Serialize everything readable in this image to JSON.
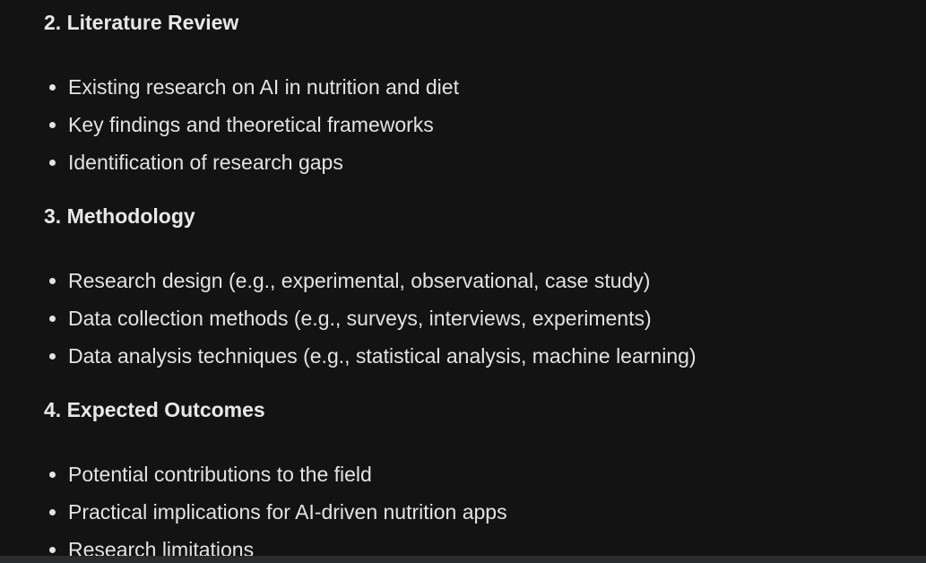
{
  "sections": [
    {
      "heading": "2. Literature Review",
      "items": [
        "Existing research on AI in nutrition and diet",
        "Key findings and theoretical frameworks",
        "Identification of research gaps"
      ]
    },
    {
      "heading": "3. Methodology",
      "items": [
        "Research design (e.g., experimental, observational, case study)",
        "Data collection methods (e.g., surveys, interviews, experiments)",
        "Data analysis techniques (e.g., statistical analysis, machine learning)"
      ]
    },
    {
      "heading": "4. Expected Outcomes",
      "items": [
        "Potential contributions to the field",
        "Practical implications for AI-driven nutrition apps",
        "Research limitations"
      ]
    }
  ],
  "colors": {
    "background": "#131314",
    "text": "#e3e3e3"
  }
}
